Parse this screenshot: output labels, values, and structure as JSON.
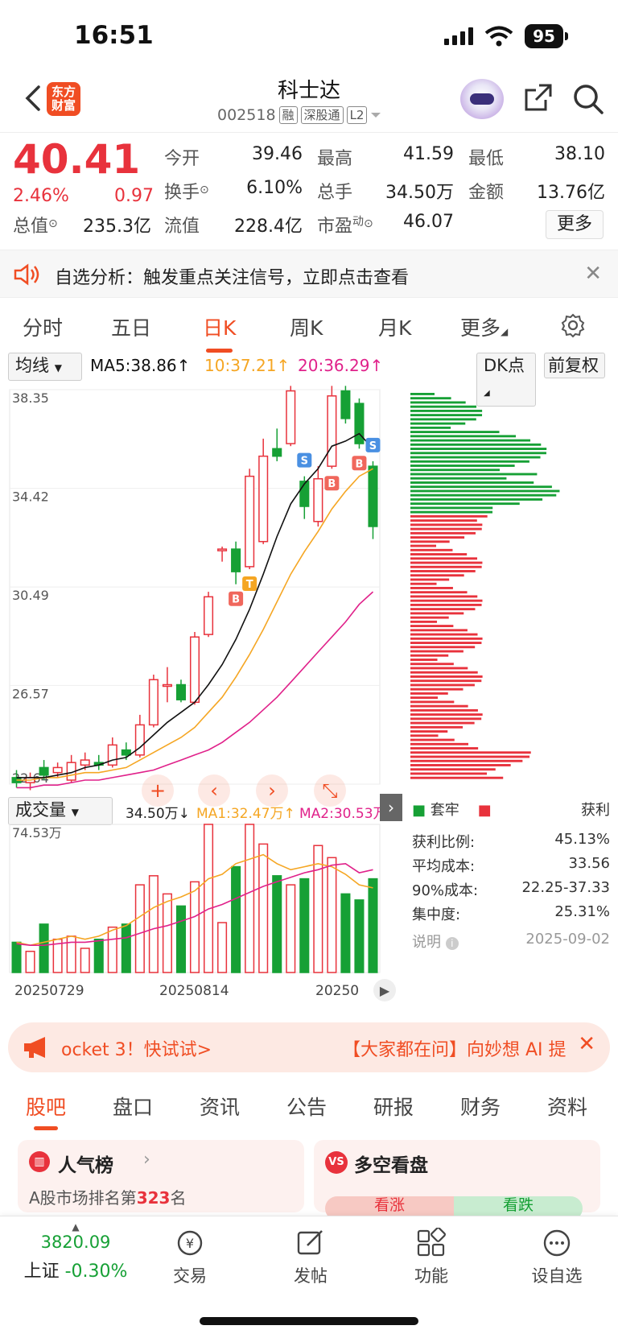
{
  "status_bar": {
    "time": "16:51",
    "battery": "95"
  },
  "header": {
    "logo": "东方财富",
    "title": "科士达",
    "code": "002518",
    "tags": [
      "融",
      "深股通",
      "L2"
    ]
  },
  "quote": {
    "price": "40.41",
    "change_pct": "2.46%",
    "change": "0.97",
    "stats": [
      {
        "label": "今开",
        "value": "39.46",
        "color": "red"
      },
      {
        "label": "最高",
        "value": "41.59",
        "color": "red"
      },
      {
        "label": "最低",
        "value": "38.10",
        "color": "green"
      },
      {
        "label": "换手",
        "value": "6.10%",
        "color": "black"
      },
      {
        "label": "总手",
        "value": "34.50万",
        "color": "black"
      },
      {
        "label": "金额",
        "value": "13.76亿",
        "color": "black"
      },
      {
        "label": "总值",
        "value": "235.3亿",
        "color": "black"
      },
      {
        "label": "流值",
        "value": "228.4亿",
        "color": "black"
      },
      {
        "label": "市盈",
        "sup": "动",
        "value": "46.07",
        "color": "black"
      }
    ],
    "more_label": "更多"
  },
  "notice": {
    "text": "自选分析：触发重点关注信号，立即点击查看"
  },
  "period_tabs": [
    "分时",
    "五日",
    "日K",
    "周K",
    "月K",
    "更多"
  ],
  "active_tab": "日K",
  "chart_controls": {
    "ma_select": "均线",
    "ma5": "MA5:38.86↑",
    "ma10": "10:37.21↑",
    "ma20": "20:36.29↑",
    "dk": "DK点",
    "fq": "前复权",
    "vol_select": "成交量",
    "vol_value": "34.50万↓",
    "vol_ma1": "MA1:32.47万↑",
    "vol_ma2": "MA2:30.53万"
  },
  "colors": {
    "up": "#e8323c",
    "down": "#16a035",
    "ma5": "#111111",
    "ma10": "#f5a623",
    "ma20": "#e0218a",
    "accent": "#f04d23"
  },
  "chart_data": [
    {
      "type": "candlestick",
      "title": "日K",
      "y_ticks": [
        "38.35",
        "34.42",
        "30.49",
        "26.57",
        "22.64"
      ],
      "candles": [
        {
          "o": 22.9,
          "c": 22.7,
          "h": 23.2,
          "l": 22.5
        },
        {
          "o": 22.7,
          "c": 22.9,
          "h": 23.1,
          "l": 22.4
        },
        {
          "o": 23.3,
          "c": 23.0,
          "h": 23.6,
          "l": 22.8
        },
        {
          "o": 23.1,
          "c": 23.3,
          "h": 23.5,
          "l": 22.9
        },
        {
          "o": 22.8,
          "c": 23.5,
          "h": 23.8,
          "l": 22.7
        },
        {
          "o": 23.4,
          "c": 23.6,
          "h": 23.9,
          "l": 23.2
        },
        {
          "o": 23.5,
          "c": 23.4,
          "h": 23.8,
          "l": 23.2
        },
        {
          "o": 23.4,
          "c": 24.2,
          "h": 24.5,
          "l": 23.3
        },
        {
          "o": 24.0,
          "c": 23.8,
          "h": 24.3,
          "l": 23.6
        },
        {
          "o": 23.8,
          "c": 25.0,
          "h": 25.4,
          "l": 23.7
        },
        {
          "o": 25.0,
          "c": 26.8,
          "h": 27.0,
          "l": 24.9
        },
        {
          "o": 26.6,
          "c": 26.6,
          "h": 27.3,
          "l": 25.9
        },
        {
          "o": 26.6,
          "c": 26.0,
          "h": 26.8,
          "l": 25.9
        },
        {
          "o": 25.9,
          "c": 28.5,
          "h": 28.7,
          "l": 25.8
        },
        {
          "o": 28.6,
          "c": 30.1,
          "h": 30.3,
          "l": 28.5
        },
        {
          "o": 32.0,
          "c": 32.0,
          "h": 32.1,
          "l": 31.5
        },
        {
          "o": 32.0,
          "c": 31.1,
          "h": 32.3,
          "l": 30.6
        },
        {
          "o": 31.3,
          "c": 34.9,
          "h": 35.2,
          "l": 31.2
        },
        {
          "o": 32.3,
          "c": 35.7,
          "h": 36.4,
          "l": 32.2
        },
        {
          "o": 36.0,
          "c": 35.7,
          "h": 36.8,
          "l": 35.5
        },
        {
          "o": 36.2,
          "c": 38.3,
          "h": 38.5,
          "l": 36.1
        },
        {
          "o": 34.7,
          "c": 33.7,
          "h": 34.9,
          "l": 33.2
        },
        {
          "o": 33.1,
          "c": 34.8,
          "h": 35.3,
          "l": 32.9
        },
        {
          "o": 35.3,
          "c": 38.1,
          "h": 38.5,
          "l": 35.2
        },
        {
          "o": 38.3,
          "c": 37.2,
          "h": 38.5,
          "l": 37.0
        },
        {
          "o": 37.8,
          "c": 36.2,
          "h": 38.0,
          "l": 36.0
        },
        {
          "o": 35.3,
          "c": 32.9,
          "h": 35.5,
          "l": 32.4
        }
      ],
      "signals": [
        {
          "i": 16,
          "label": "B"
        },
        {
          "i": 17,
          "label": "T"
        },
        {
          "i": 21,
          "label": "S"
        },
        {
          "i": 23,
          "label": "B"
        },
        {
          "i": 25,
          "label": "B"
        },
        {
          "i": 26,
          "label": "S"
        }
      ],
      "ma5": [
        22.9,
        22.9,
        22.9,
        23.0,
        23.1,
        23.3,
        23.4,
        23.6,
        23.7,
        24.1,
        24.6,
        25.1,
        25.5,
        25.9,
        26.6,
        27.4,
        28.4,
        29.6,
        31.0,
        32.5,
        33.8,
        34.6,
        35.2,
        36.1,
        36.3,
        36.6,
        36.0
      ],
      "ma10": [
        22.8,
        22.8,
        22.9,
        22.9,
        23.0,
        23.1,
        23.1,
        23.2,
        23.3,
        23.6,
        23.9,
        24.2,
        24.5,
        24.9,
        25.5,
        26.1,
        26.9,
        27.8,
        28.8,
        29.9,
        31.0,
        31.9,
        32.7,
        33.6,
        34.3,
        34.9,
        35.2
      ],
      "ma20": [
        22.5,
        22.5,
        22.6,
        22.6,
        22.7,
        22.8,
        22.8,
        22.9,
        23.0,
        23.1,
        23.2,
        23.4,
        23.6,
        23.8,
        24.0,
        24.3,
        24.7,
        25.1,
        25.6,
        26.1,
        26.7,
        27.3,
        27.9,
        28.5,
        29.1,
        29.8,
        30.3
      ]
    },
    {
      "type": "bar",
      "title": "成交量",
      "y_max_label": "74.53万",
      "x_labels": [
        "20250729",
        "20250814",
        "20250"
      ],
      "values": [
        20,
        14,
        32,
        22,
        24,
        16,
        22,
        30,
        32,
        58,
        64,
        52,
        44,
        60,
        98,
        33,
        70,
        98,
        85,
        64,
        58,
        62,
        84,
        76,
        52,
        48,
        62
      ],
      "ma1": [
        20,
        18,
        20,
        22,
        24,
        22,
        24,
        28,
        31,
        37,
        43,
        47,
        50,
        54,
        62,
        65,
        72,
        75,
        78,
        72,
        68,
        70,
        72,
        70,
        65,
        58,
        56
      ],
      "ma2": [
        19,
        18,
        18,
        19,
        20,
        20,
        21,
        22,
        23,
        26,
        29,
        31,
        34,
        37,
        42,
        45,
        49,
        53,
        57,
        60,
        63,
        66,
        68,
        71,
        72,
        66,
        68
      ]
    },
    {
      "type": "bar",
      "title": "筹码分布",
      "legend": [
        "套牢",
        "获利"
      ]
    }
  ],
  "chip_stats": [
    {
      "label": "获利比例:",
      "value": "45.13%"
    },
    {
      "label": "平均成本:",
      "value": "33.56"
    },
    {
      "label": "90%成本:",
      "value": "22.25-37.33"
    },
    {
      "label": "集中度:",
      "value": "25.31%"
    }
  ],
  "chip_note": {
    "label": "说明",
    "date": "2025-09-02"
  },
  "ad": {
    "left": "ocket 3！快试试>",
    "right": "【大家都在问】向妙想 AI 提"
  },
  "bottom_tabs": [
    "股吧",
    "盘口",
    "资讯",
    "公告",
    "研报",
    "财务",
    "资料"
  ],
  "cards": {
    "rank_title": "人气榜",
    "rank_text_prefix": "A股市场排名第",
    "rank_num": "323",
    "rank_suffix": "名",
    "vs_title": "多空看盘",
    "bull": "看涨",
    "bear": "看跌"
  },
  "bottom_nav": {
    "index_value": "3820.09",
    "index_name": "上证",
    "index_change": "-0.30%",
    "items": [
      "交易",
      "发帖",
      "功能",
      "设自选"
    ]
  }
}
